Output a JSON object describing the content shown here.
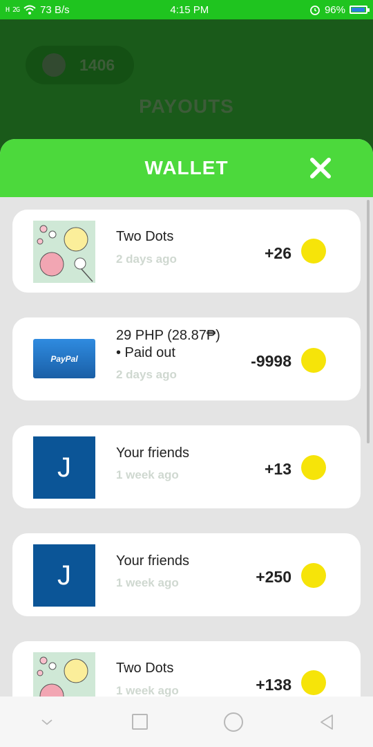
{
  "status_bar": {
    "signal_text": "H 2G",
    "speed": "73 B/s",
    "time": "4:15 PM",
    "battery": "96%",
    "icons": [
      "signal-icon",
      "wifi-icon",
      "alarm-icon",
      "battery-icon"
    ]
  },
  "background": {
    "coin_count": "1406",
    "title": "PAYOUTS"
  },
  "wallet": {
    "title": "WALLET",
    "close_icon": "close-icon",
    "items": [
      {
        "title": "Two Dots",
        "time": "2 days ago",
        "amount": "+26",
        "icon": "two-dots-game-icon"
      },
      {
        "title_line1": "29 PHP (28.87₱)",
        "title_line2": "• Paid out",
        "time": "2 days ago",
        "amount": "-9998",
        "icon": "paypal-logo",
        "thumb_text": "PayPal"
      },
      {
        "title": "Your friends",
        "time": "1 week ago",
        "amount": "+13",
        "icon": "friend-avatar",
        "initial": "J"
      },
      {
        "title": "Your friends",
        "time": "1 week ago",
        "amount": "+250",
        "icon": "friend-avatar",
        "initial": "J"
      },
      {
        "title": "Two Dots",
        "time": "1 week ago",
        "amount": "+138",
        "icon": "two-dots-game-icon"
      }
    ]
  },
  "colors": {
    "status_bar": "#1fc41f",
    "header_green": "#4cd93c",
    "dim_background": "#1a5a1a",
    "coin": "#f6e409",
    "friend_avatar": "#0b5597"
  },
  "nav_bar": {
    "icons": [
      "chevron-down-icon",
      "recents-icon",
      "home-icon",
      "back-icon"
    ]
  }
}
